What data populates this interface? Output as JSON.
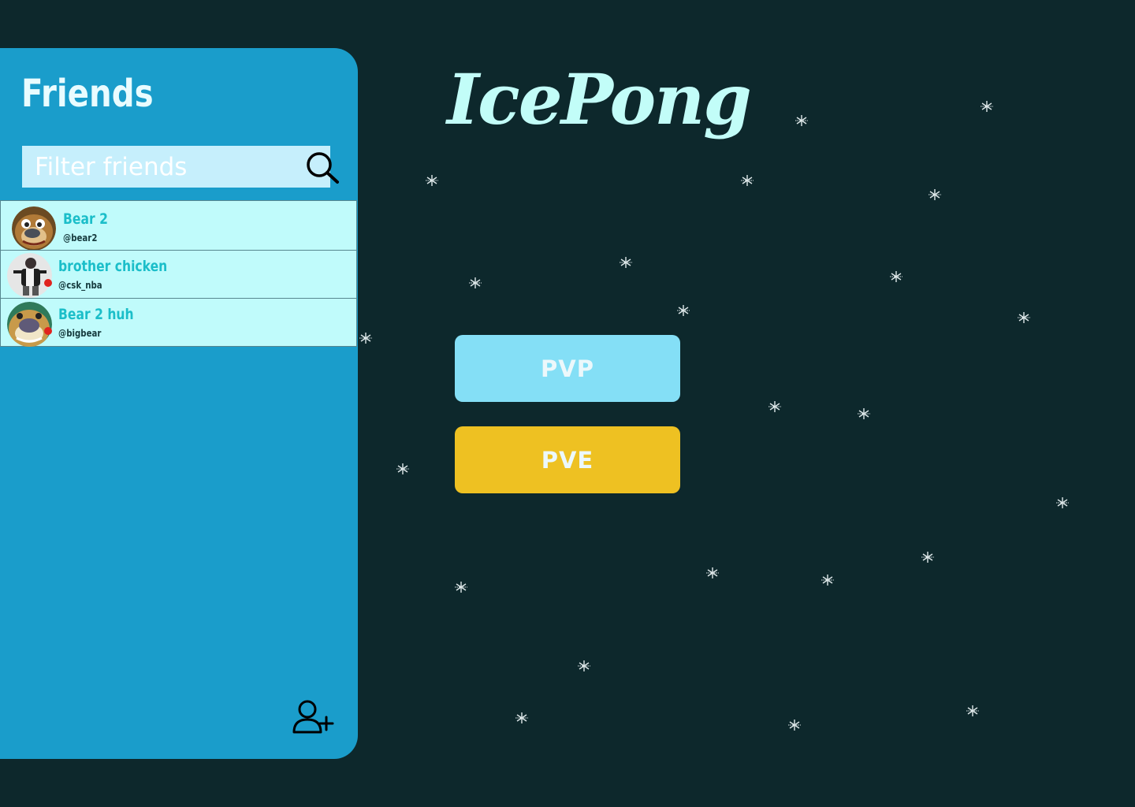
{
  "sidebar": {
    "title": "Friends",
    "search_placeholder": "Filter friends",
    "friends": [
      {
        "name": "Bear 2",
        "handle": "@bear2",
        "online": false
      },
      {
        "name": "brother chicken",
        "handle": "@csk_nba",
        "online": true
      },
      {
        "name": "Bear 2 huh",
        "handle": "@bigbear",
        "online": true
      }
    ],
    "status_dot_color": "#e0231e"
  },
  "main": {
    "logo": "IcePong",
    "pvp_label": "PVP",
    "pve_label": "PVE"
  },
  "icons": {
    "search": "search-icon",
    "add_friend": "add-user-icon",
    "snowflake": "snowflake-icon"
  },
  "colors": {
    "background": "#0d282c",
    "sidebar": "#1a9dcb",
    "friend_row": "#c0fbfb",
    "pvp_button": "#84dff6",
    "pve_button": "#eec122",
    "logo": "#c2fdf8"
  }
}
